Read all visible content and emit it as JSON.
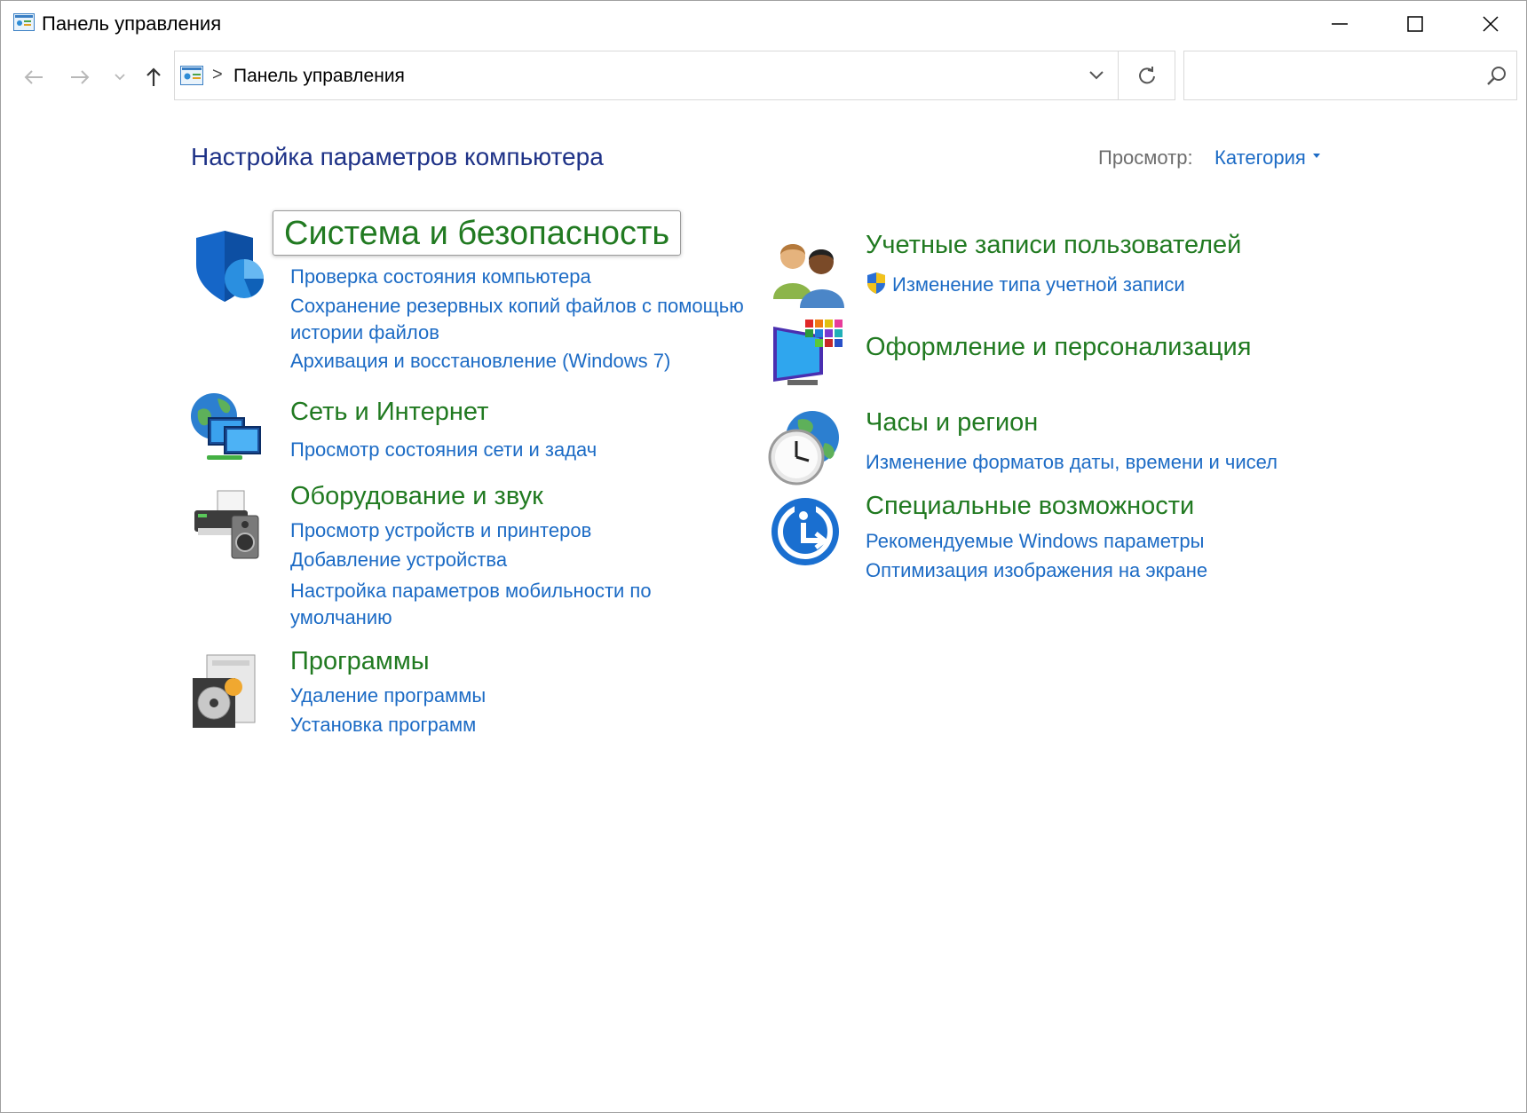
{
  "window": {
    "title": "Панель управления"
  },
  "nav": {
    "breadcrumb_sep": ">",
    "address": "Панель управления",
    "search_placeholder": ""
  },
  "content": {
    "page_title": "Настройка параметров компьютера",
    "view_label": "Просмотр:",
    "view_value": "Категория"
  },
  "categories": [
    {
      "title": "Система и безопасность",
      "icon": "shield-icon",
      "links": [
        "Проверка состояния компьютера",
        "Сохранение резервных копий файлов с помощью истории файлов",
        "Архивация и восстановление (Windows 7)"
      ]
    },
    {
      "title": "Сеть и Интернет",
      "icon": "network-globe-icon",
      "links": [
        "Просмотр состояния сети и задач"
      ]
    },
    {
      "title": "Оборудование и звук",
      "icon": "printer-speaker-icon",
      "links": [
        "Просмотр устройств и принтеров",
        "Добавление устройства",
        "Настройка параметров мобильности по умолчанию"
      ]
    },
    {
      "title": "Программы",
      "icon": "programs-disc-icon",
      "links": [
        "Удаление программы",
        "Установка программ"
      ]
    },
    {
      "title": "Учетные записи пользователей",
      "icon": "users-icon",
      "links": [
        "Изменение типа учетной записи"
      ]
    },
    {
      "title": "Оформление и персонализация",
      "icon": "monitor-palette-icon",
      "links": []
    },
    {
      "title": "Часы и регион",
      "icon": "clock-globe-icon",
      "links": [
        "Изменение форматов даты, времени и чисел"
      ]
    },
    {
      "title": "Специальные возможности",
      "icon": "accessibility-icon",
      "links": [
        "Рекомендуемые Windows параметры",
        "Оптимизация изображения на экране"
      ]
    }
  ],
  "colors": {
    "category_title": "#217a21",
    "link": "#1c6bc5",
    "page_title": "#1e3287"
  }
}
